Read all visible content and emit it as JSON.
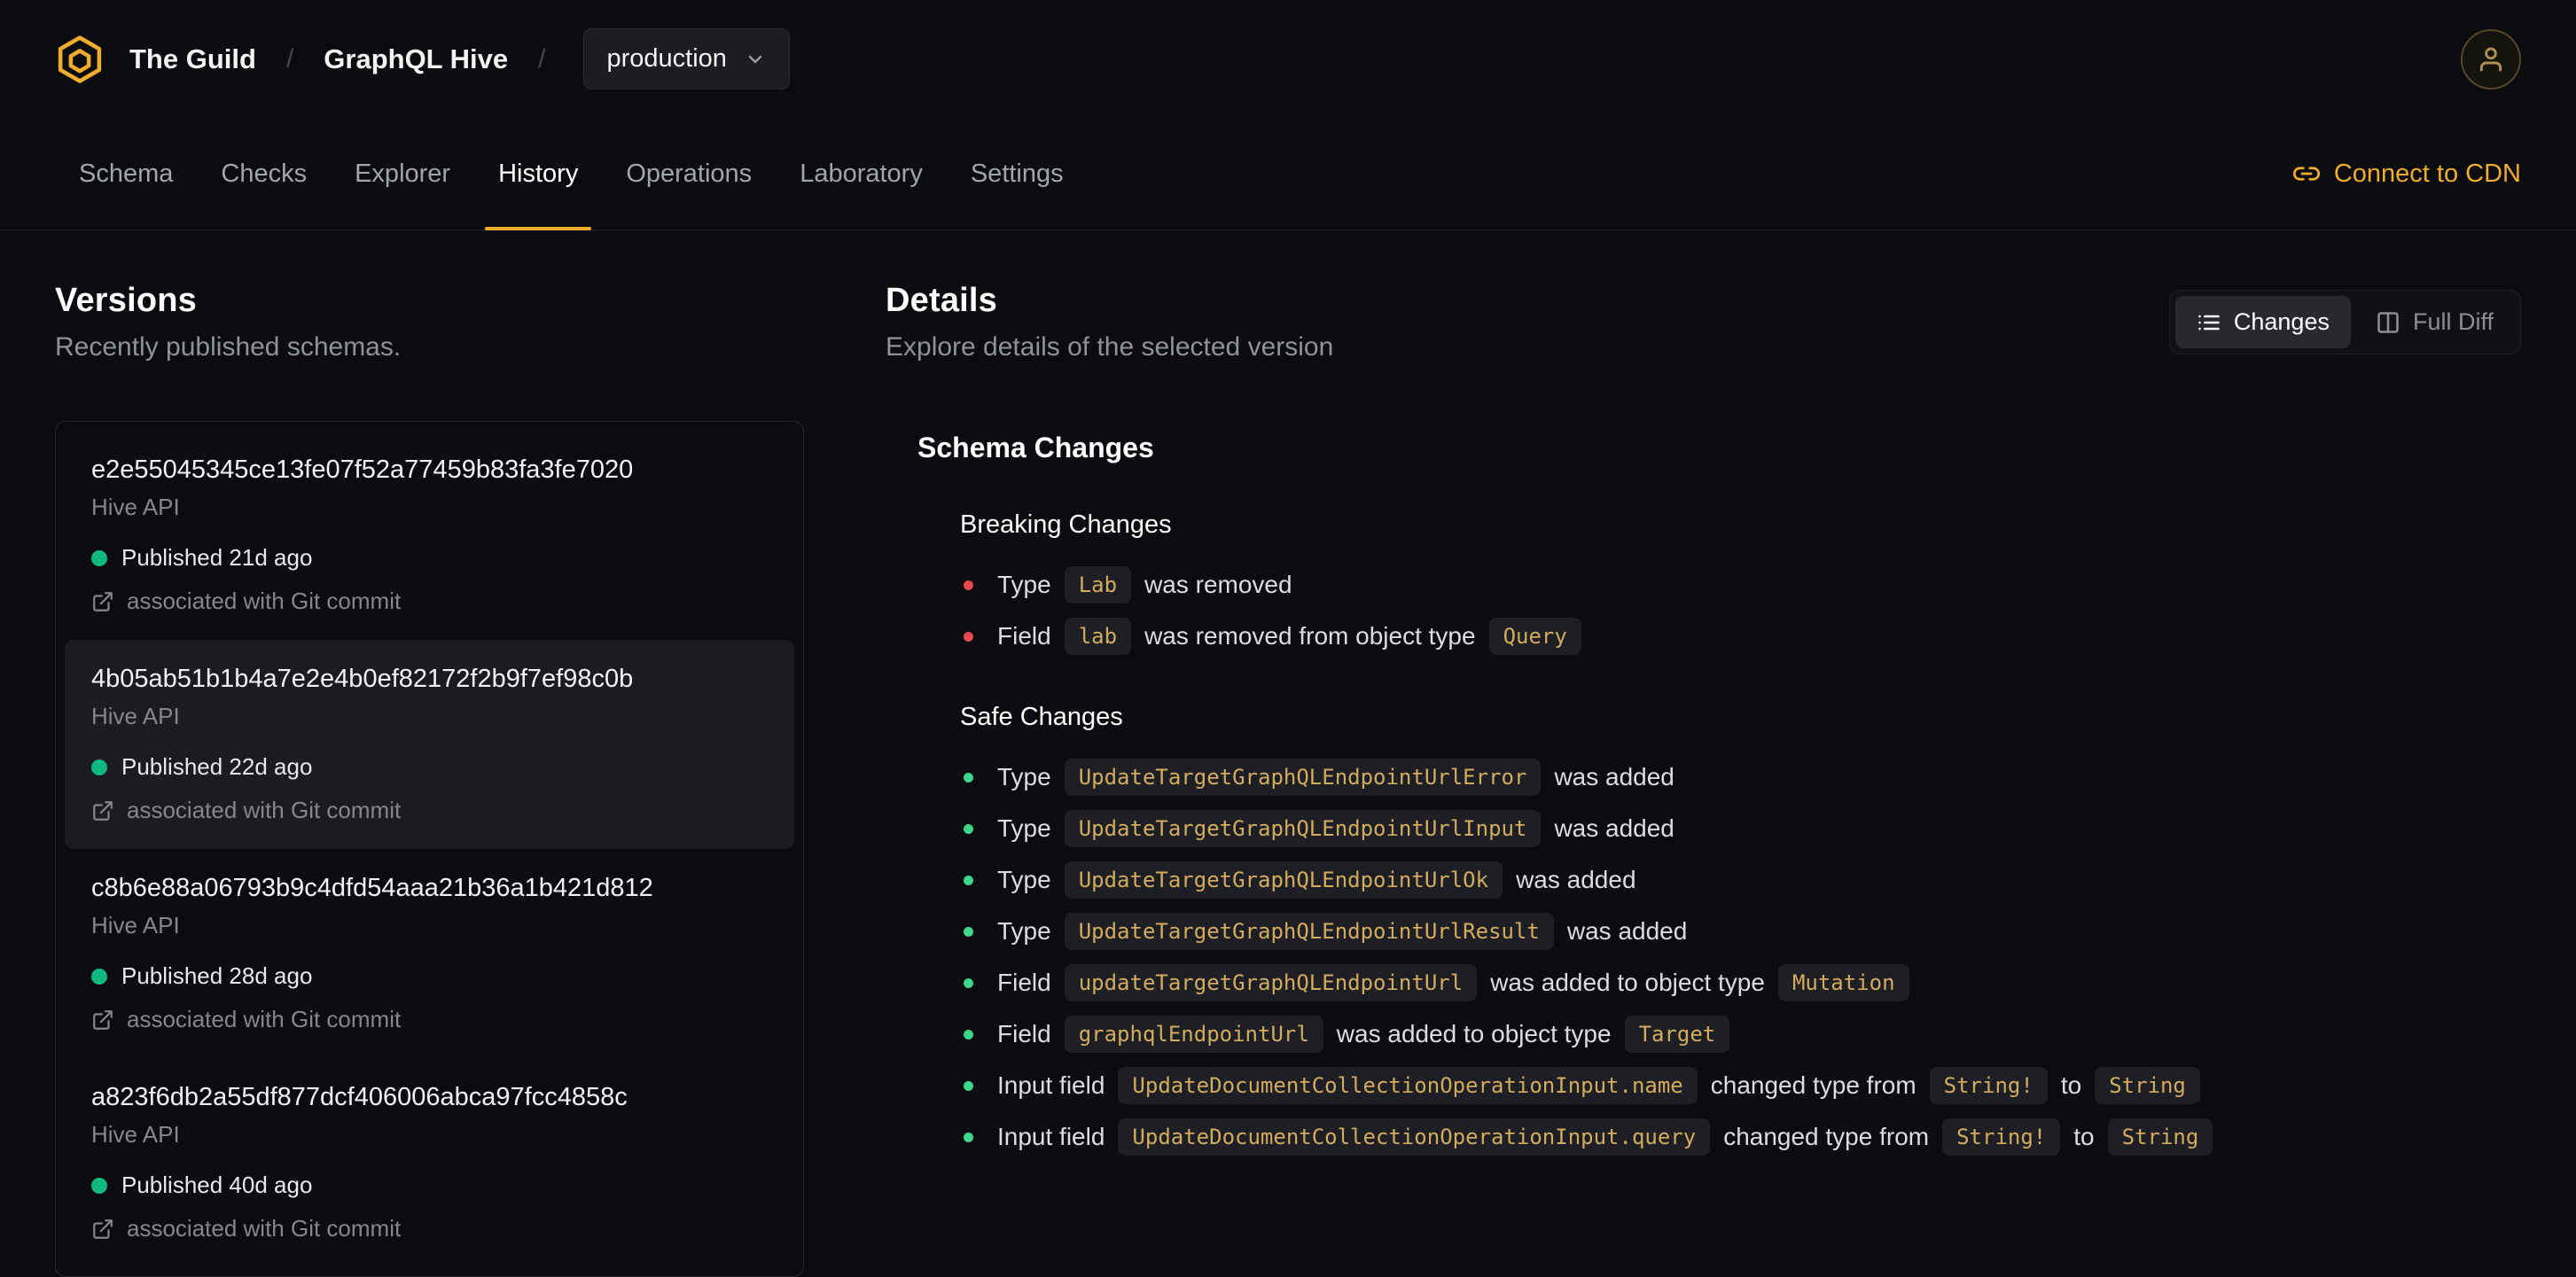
{
  "colors": {
    "accent": "#efac2d",
    "published_green": "#10b981",
    "safe_green": "#3dd68c",
    "breaking_red": "#e5484d",
    "code_text": "#d3ab5e"
  },
  "header": {
    "org": "The Guild",
    "separator": "/",
    "project": "GraphQL Hive",
    "target": "production"
  },
  "tabs": [
    {
      "label": "Schema",
      "active": false
    },
    {
      "label": "Checks",
      "active": false
    },
    {
      "label": "Explorer",
      "active": false
    },
    {
      "label": "History",
      "active": true
    },
    {
      "label": "Operations",
      "active": false
    },
    {
      "label": "Laboratory",
      "active": false
    },
    {
      "label": "Settings",
      "active": false
    }
  ],
  "connect_cdn": "Connect to CDN",
  "versions": {
    "title": "Versions",
    "subtitle": "Recently published schemas.",
    "items": [
      {
        "hash": "e2e55045345ce13fe07f52a77459b83fa3fe7020",
        "service": "Hive API",
        "published": "Published 21d ago",
        "git": "associated with Git commit",
        "selected": false
      },
      {
        "hash": "4b05ab51b1b4a7e2e4b0ef82172f2b9f7ef98c0b",
        "service": "Hive API",
        "published": "Published 22d ago",
        "git": "associated with Git commit",
        "selected": true
      },
      {
        "hash": "c8b6e88a06793b9c4dfd54aaa21b36a1b421d812",
        "service": "Hive API",
        "published": "Published 28d ago",
        "git": "associated with Git commit",
        "selected": false
      },
      {
        "hash": "a823f6db2a55df877dcf406006abca97fcc4858c",
        "service": "Hive API",
        "published": "Published 40d ago",
        "git": "associated with Git commit",
        "selected": false
      }
    ]
  },
  "details": {
    "title": "Details",
    "subtitle": "Explore details of the selected version",
    "toggle": {
      "changes": "Changes",
      "full_diff": "Full Diff"
    },
    "schema_changes_title": "Schema Changes",
    "breaking": {
      "title": "Breaking Changes",
      "items": [
        {
          "parts": [
            {
              "t": "text",
              "v": "Type"
            },
            {
              "t": "code",
              "v": "Lab"
            },
            {
              "t": "text",
              "v": "was removed"
            }
          ]
        },
        {
          "parts": [
            {
              "t": "text",
              "v": "Field"
            },
            {
              "t": "code",
              "v": "lab"
            },
            {
              "t": "text",
              "v": "was removed from object type"
            },
            {
              "t": "code",
              "v": "Query"
            }
          ]
        }
      ]
    },
    "safe": {
      "title": "Safe Changes",
      "items": [
        {
          "parts": [
            {
              "t": "text",
              "v": "Type"
            },
            {
              "t": "code",
              "v": "UpdateTargetGraphQLEndpointUrlError"
            },
            {
              "t": "text",
              "v": "was added"
            }
          ]
        },
        {
          "parts": [
            {
              "t": "text",
              "v": "Type"
            },
            {
              "t": "code",
              "v": "UpdateTargetGraphQLEndpointUrlInput"
            },
            {
              "t": "text",
              "v": "was added"
            }
          ]
        },
        {
          "parts": [
            {
              "t": "text",
              "v": "Type"
            },
            {
              "t": "code",
              "v": "UpdateTargetGraphQLEndpointUrlOk"
            },
            {
              "t": "text",
              "v": "was added"
            }
          ]
        },
        {
          "parts": [
            {
              "t": "text",
              "v": "Type"
            },
            {
              "t": "code",
              "v": "UpdateTargetGraphQLEndpointUrlResult"
            },
            {
              "t": "text",
              "v": "was added"
            }
          ]
        },
        {
          "parts": [
            {
              "t": "text",
              "v": "Field"
            },
            {
              "t": "code",
              "v": "updateTargetGraphQLEndpointUrl"
            },
            {
              "t": "text",
              "v": "was added to object type"
            },
            {
              "t": "code",
              "v": "Mutation"
            }
          ]
        },
        {
          "parts": [
            {
              "t": "text",
              "v": "Field"
            },
            {
              "t": "code",
              "v": "graphqlEndpointUrl"
            },
            {
              "t": "text",
              "v": "was added to object type"
            },
            {
              "t": "code",
              "v": "Target"
            }
          ]
        },
        {
          "parts": [
            {
              "t": "text",
              "v": "Input field"
            },
            {
              "t": "code",
              "v": "UpdateDocumentCollectionOperationInput.name"
            },
            {
              "t": "text",
              "v": "changed type from"
            },
            {
              "t": "code",
              "v": "String!"
            },
            {
              "t": "text",
              "v": "to"
            },
            {
              "t": "code",
              "v": "String"
            }
          ]
        },
        {
          "parts": [
            {
              "t": "text",
              "v": "Input field"
            },
            {
              "t": "code",
              "v": "UpdateDocumentCollectionOperationInput.query"
            },
            {
              "t": "text",
              "v": "changed type from"
            },
            {
              "t": "code",
              "v": "String!"
            },
            {
              "t": "text",
              "v": "to"
            },
            {
              "t": "code",
              "v": "String"
            }
          ]
        }
      ]
    }
  }
}
